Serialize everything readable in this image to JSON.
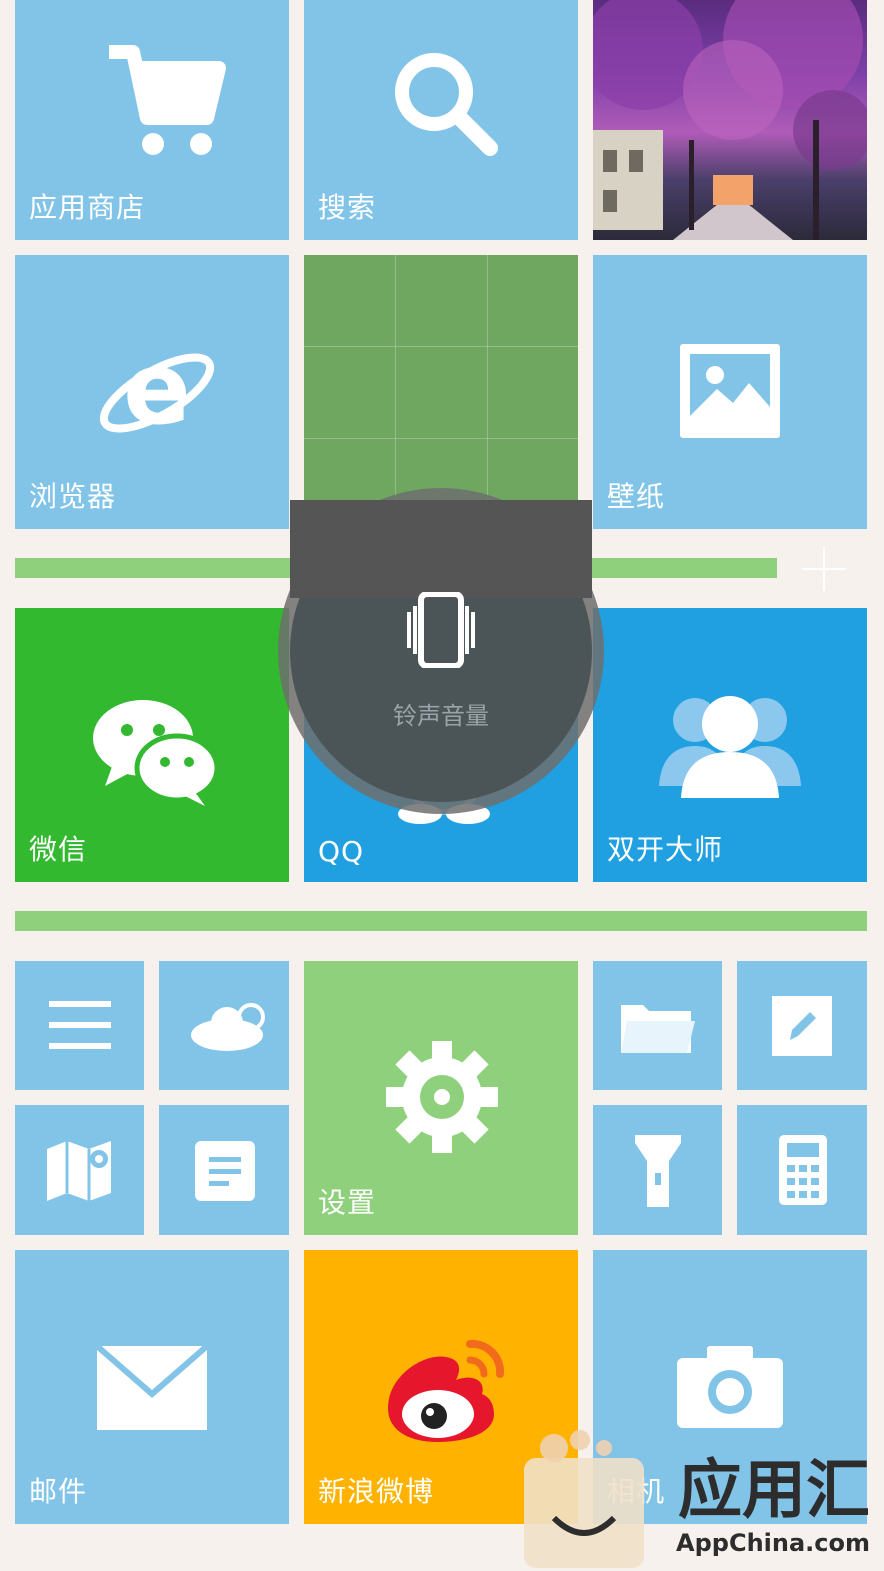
{
  "tiles": {
    "app_store": "应用商店",
    "search": "搜索",
    "browser": "浏览器",
    "wallpaper": "壁纸",
    "wechat": "微信",
    "qq": "QQ",
    "dual_open": "双开大师",
    "settings": "设置",
    "mail": "邮件",
    "weibo": "新浪微博",
    "camera": "相机"
  },
  "popup": {
    "label": "铃声音量",
    "icon": "vibrate-icon"
  },
  "watermark": {
    "name": "应用汇",
    "url": "AppChina.com"
  },
  "colors": {
    "tile_blue": "#82c4e8",
    "wechat_green": "#33b92f",
    "qq_blue": "#20a0e0",
    "settings_green": "#8fd07d",
    "weibo_yellow": "#ffb300",
    "divider_green": "#8fd07d"
  }
}
